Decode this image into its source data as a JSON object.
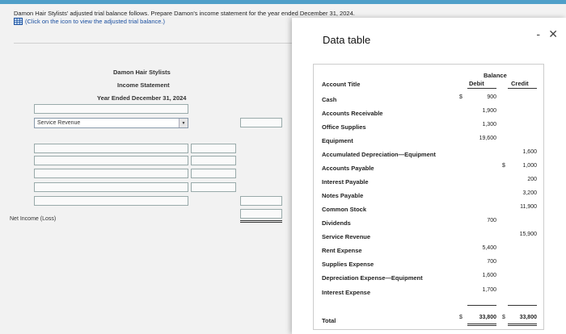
{
  "question": {
    "text": "Damon Hair Stylists' adjusted trial balance follows. Prepare Damon's income statement for the year ended December 31, 2024.",
    "link": "(Click on the icon to view the adjusted trial balance.)"
  },
  "statement": {
    "company": "Damon Hair Stylists",
    "title": "Income Statement",
    "period": "Year Ended December 31, 2024",
    "dropdown_value": "Service Revenue",
    "net_income_label": "Net Income (Loss)"
  },
  "modal": {
    "title": "Data table",
    "minimize": "-",
    "close": "✕",
    "header_balance": "Balance",
    "header_account": "Account Title",
    "header_debit": "Debit",
    "header_credit": "Credit",
    "rows": [
      {
        "account": "Cash",
        "debit": "900",
        "credit": ""
      },
      {
        "account": "Accounts Receivable",
        "debit": "1,900",
        "credit": ""
      },
      {
        "account": "Office Supplies",
        "debit": "1,300",
        "credit": ""
      },
      {
        "account": "Equipment",
        "debit": "19,600",
        "credit": ""
      },
      {
        "account": "Accumulated Depreciation—Equipment",
        "debit": "",
        "credit": "1,600"
      },
      {
        "account": "Accounts Payable",
        "debit": "",
        "credit": "1,000"
      },
      {
        "account": "Interest Payable",
        "debit": "",
        "credit": "200"
      },
      {
        "account": "Notes Payable",
        "debit": "",
        "credit": "3,200"
      },
      {
        "account": "Common Stock",
        "debit": "",
        "credit": "11,900"
      },
      {
        "account": "Dividends",
        "debit": "700",
        "credit": ""
      },
      {
        "account": "Service Revenue",
        "debit": "",
        "credit": "15,900"
      },
      {
        "account": "Rent Expense",
        "debit": "5,400",
        "credit": ""
      },
      {
        "account": "Supplies Expense",
        "debit": "700",
        "credit": ""
      },
      {
        "account": "Depreciation Expense—Equipment",
        "debit": "1,600",
        "credit": ""
      },
      {
        "account": "Interest Expense",
        "debit": "1,700",
        "credit": ""
      }
    ],
    "total_label": "Total",
    "total_debit": "33,800",
    "total_credit": "33,800",
    "dollar": "$"
  }
}
